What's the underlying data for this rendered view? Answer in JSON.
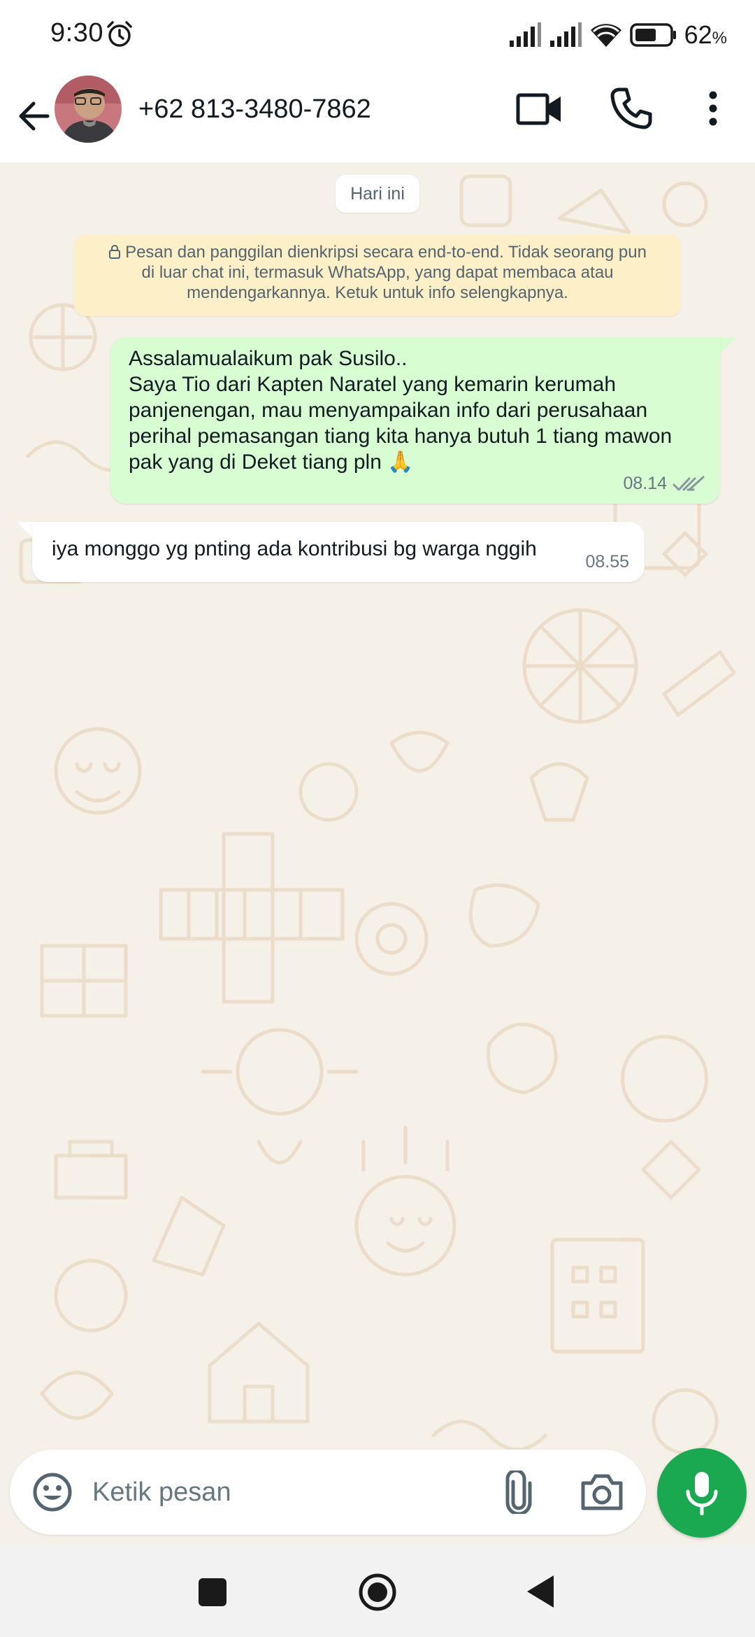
{
  "status_bar": {
    "time": "9:30",
    "battery_percent": "62",
    "battery_unit": "%",
    "battery_level": 0.62
  },
  "header": {
    "contact_name": "+62 813-3480-7862"
  },
  "chat": {
    "date_divider": "Hari ini",
    "encryption_notice": "Pesan dan panggilan dienkripsi secara end-to-end. Tidak seorang pun di luar chat ini, termasuk WhatsApp, yang dapat membaca atau mendengarkannya. Ketuk untuk info selengkapnya.",
    "messages": [
      {
        "direction": "outgoing",
        "text": "Assalamualaikum pak Susilo..\nSaya Tio dari Kapten Naratel yang kemarin kerumah panjenengan, mau menyampaikan info dari perusahaan perihal pemasangan tiang kita hanya butuh 1 tiang mawon pak yang di Deket tiang pln 🙏",
        "time": "08.14",
        "status": "read"
      },
      {
        "direction": "incoming",
        "text": "iya monggo yg pnting ada kontribusi bg warga nggih",
        "time": "08.55"
      }
    ]
  },
  "composer": {
    "placeholder": "Ketik pesan"
  },
  "colors": {
    "outgoing_bubble": "#d9fdd3",
    "incoming_bubble": "#ffffff",
    "notice_bg": "#fdefc8",
    "chat_bg": "#f5f0e8",
    "accent_green": "#1aa851",
    "read_ticks": "#8696a0"
  },
  "icons": {
    "status": [
      "alarm-icon",
      "signal-icon",
      "signal-icon",
      "wifi-icon",
      "battery-icon"
    ],
    "header": [
      "back-arrow-icon",
      "video-camera-icon",
      "phone-icon",
      "more-vertical-icon"
    ],
    "composer": [
      "emoji-icon",
      "paperclip-icon",
      "camera-icon",
      "mic-icon"
    ],
    "nav": [
      "recents-square-icon",
      "home-circle-icon",
      "back-triangle-icon"
    ]
  }
}
